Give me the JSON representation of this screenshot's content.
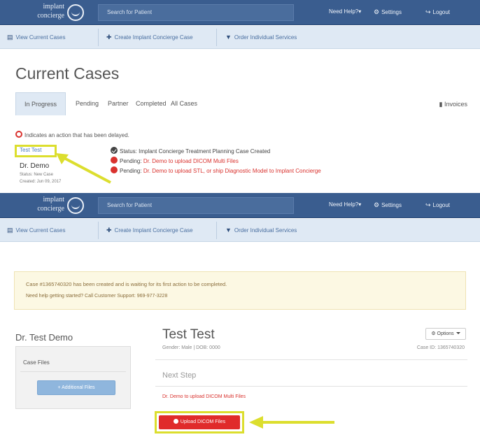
{
  "colors": {
    "navbar": "#3a5d8f",
    "subnav": "#dfe9f4",
    "highlight": "#dcde2e",
    "danger": "#d9322e",
    "link": "#4a7cbf"
  },
  "navbar": {
    "logo_line1": "implant",
    "logo_line2": "concierge",
    "search_placeholder": "Search for Patient",
    "help": "Need Help?",
    "help_caret": "▾",
    "settings": "Settings",
    "logout": "Logout",
    "settings_icon": "gear-icon",
    "logout_icon": "logout-icon"
  },
  "subnav": {
    "view_cases": "View Current Cases",
    "create_case": "Create Implant Concierge Case",
    "order_services": "Order Individual Services"
  },
  "top": {
    "page_title": "Current Cases",
    "tabs": [
      "In Progress",
      "Pending",
      "Partner",
      "Completed",
      "All Cases"
    ],
    "invoices": "Invoices",
    "delay_note": "Indicates an action that has been delayed.",
    "case_link": "Test Test",
    "patient": "Dr. Demo",
    "case_status": "Status: New Case",
    "case_created": "Created: Jun 09, 2017",
    "status_rows": [
      {
        "label": "Status:",
        "text": "Implant Concierge Treatment Planning Case Created"
      },
      {
        "label": "Pending:",
        "text": "Dr. Demo to upload DICOM Multi Files"
      },
      {
        "label": "Pending:",
        "text": "Dr. Demo to upload STL, or ship Diagnostic Model to Implant Concierge"
      }
    ]
  },
  "bottom": {
    "alert_line1": "Case #1365740320 has been created and is waiting for its first action to be completed.",
    "alert_line2": "Need help getting started? Call Customer Support: 969-977-3228",
    "doctor": "Dr. Test Demo",
    "case_files": "Case Files",
    "add_files": "+ Additional Files",
    "case_title": "Test Test",
    "case_meta": "Gender: Male | DOB: 0000",
    "options": "Options",
    "case_id": "Case ID: 1365740320",
    "next_step": "Next Step",
    "pending_text": "Dr. Demo to upload DICOM Multi Files",
    "upload_button": "Upload DICOM Files"
  }
}
